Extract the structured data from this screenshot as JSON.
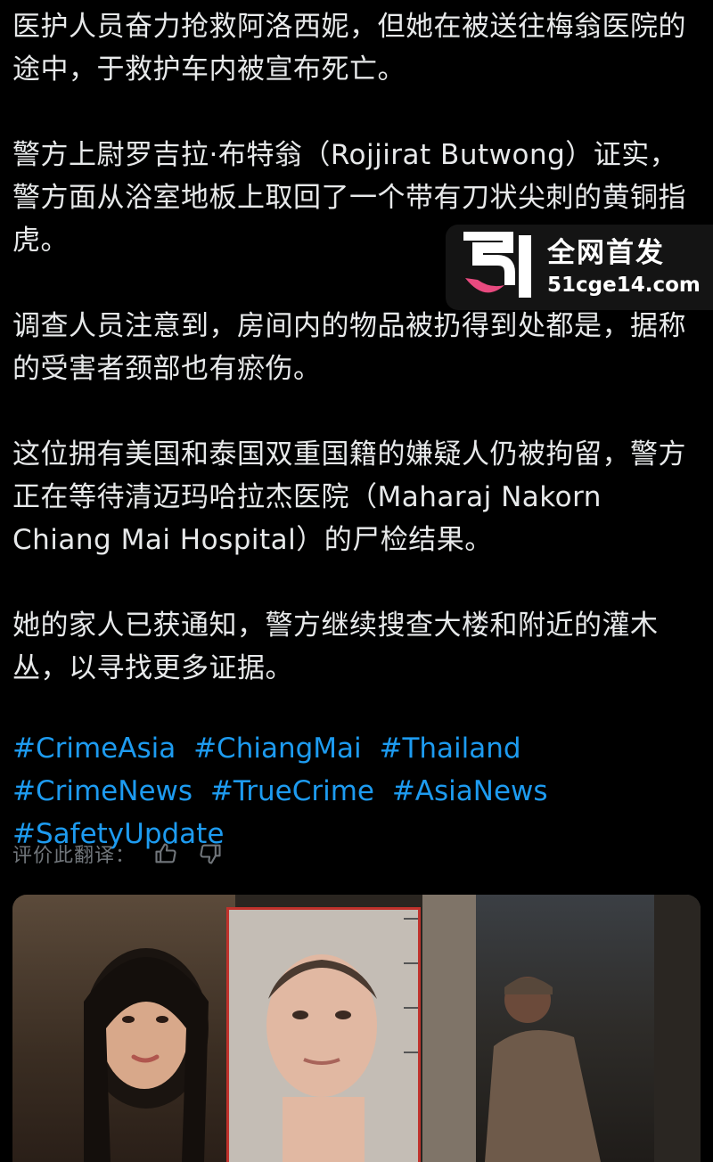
{
  "post": {
    "paragraphs": [
      "医护人员奋力抢救阿洛西妮，但她在被送往梅翁医院的途中，于救护车内被宣布死亡。",
      "警方上尉罗吉拉·布特翁（Rojjirat Butwong）证实，警方面从浴室地板上取回了一个带有刀状尖刺的黄铜指虎。",
      "调查人员注意到，房间内的物品被扔得到处都是，据称的受害者颈部也有瘀伤。",
      "这位拥有美国和泰国双重国籍的嫌疑人仍被拘留，警方正在等待清迈玛哈拉杰医院（Maharaj Nakorn Chiang Mai Hospital）的尸检结果。",
      "她的家人已获通知，警方继续搜查大楼和附近的灌木丛，以寻找更多证据。"
    ],
    "hashtags": [
      "#CrimeAsia",
      "#ChiangMai",
      "#Thailand",
      "#CrimeNews",
      "#TrueCrime",
      "#AsiaNews",
      "#SafetyUpdate"
    ]
  },
  "rating": {
    "label": "评价此翻译：",
    "thumbs_up_icon": "thumbs-up-icon",
    "thumbs_down_icon": "thumbs-down-icon"
  },
  "watermark": {
    "title": "全网首发",
    "url": "51cge14.com",
    "logo_icon": "51-logo"
  },
  "colors": {
    "background": "#000000",
    "text": "#e7e9ea",
    "link": "#1d9bf0",
    "muted": "#71767b",
    "logo_pink": "#e84a7f"
  }
}
